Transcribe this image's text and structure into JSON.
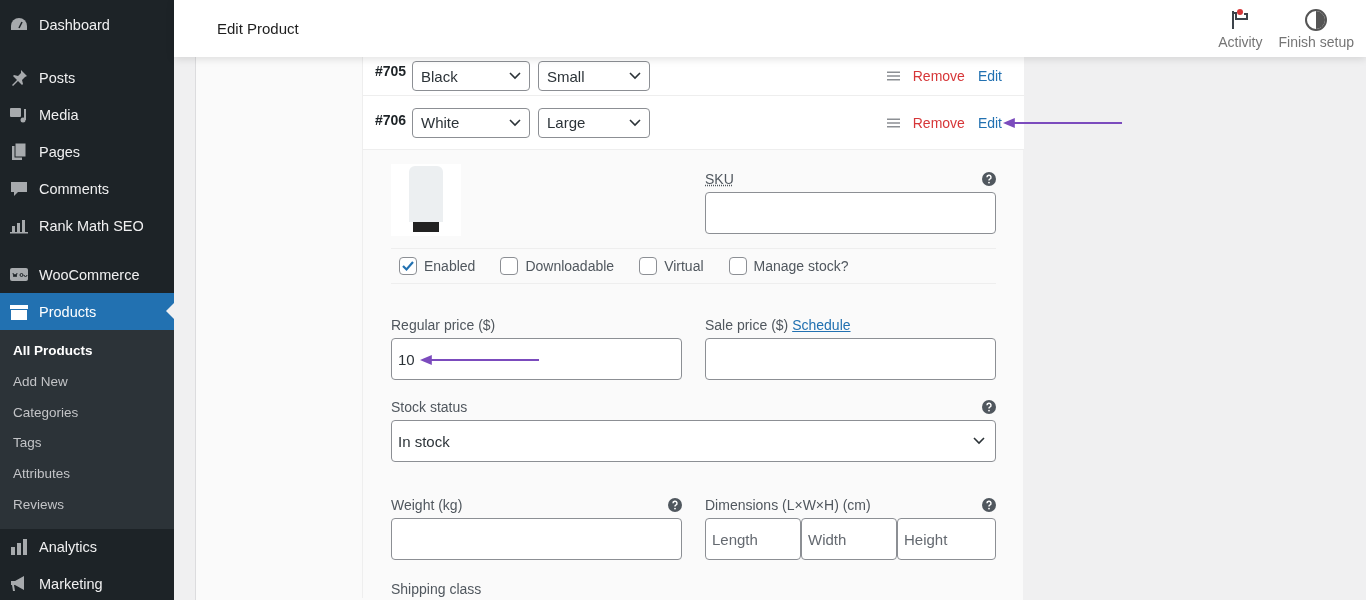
{
  "sidebar": {
    "groups": [
      [
        {
          "label": "Dashboard",
          "selected": false
        }
      ],
      [
        {
          "label": "Posts",
          "selected": false
        },
        {
          "label": "Media",
          "selected": false
        },
        {
          "label": "Pages",
          "selected": false
        },
        {
          "label": "Comments",
          "selected": false
        },
        {
          "label": "Rank Math SEO",
          "selected": false
        }
      ],
      [
        {
          "label": "WooCommerce",
          "selected": false
        },
        {
          "label": "Products",
          "selected": true,
          "children": [
            {
              "label": "All Products",
              "selected": true
            },
            {
              "label": "Add New",
              "selected": false
            },
            {
              "label": "Categories",
              "selected": false
            },
            {
              "label": "Tags",
              "selected": false
            },
            {
              "label": "Attributes",
              "selected": false
            },
            {
              "label": "Reviews",
              "selected": false
            }
          ]
        },
        {
          "label": "Analytics",
          "selected": false
        },
        {
          "label": "Marketing",
          "selected": false
        }
      ]
    ]
  },
  "header": {
    "title": "Edit Product",
    "actions": [
      {
        "label": "Activity"
      },
      {
        "label": "Finish setup"
      }
    ]
  },
  "variations": [
    {
      "number": "#705",
      "attributes": [
        "Black",
        "Small"
      ],
      "remove": "Remove",
      "edit": "Edit",
      "expanded": false
    },
    {
      "number": "#706",
      "attributes": [
        "White",
        "Large"
      ],
      "remove": "Remove",
      "edit": "Edit",
      "expanded": true
    }
  ],
  "editor": {
    "sku_label": "SKU",
    "options": [
      {
        "label": "Enabled",
        "checked": true
      },
      {
        "label": "Downloadable",
        "checked": false
      },
      {
        "label": "Virtual",
        "checked": false
      },
      {
        "label": "Manage stock?",
        "checked": false
      }
    ],
    "regular_price": {
      "label": "Regular price ($)",
      "value": "10"
    },
    "sale_price": {
      "label": "Sale price ($)",
      "link": "Schedule"
    },
    "stock_status": {
      "label": "Stock status",
      "value": "In stock"
    },
    "weight": {
      "label": "Weight (kg)"
    },
    "dimensions": {
      "label": "Dimensions (L×W×H) (cm)",
      "placeholders": [
        "Length",
        "Width",
        "Height"
      ]
    },
    "shipping_class": {
      "label": "Shipping class"
    }
  }
}
